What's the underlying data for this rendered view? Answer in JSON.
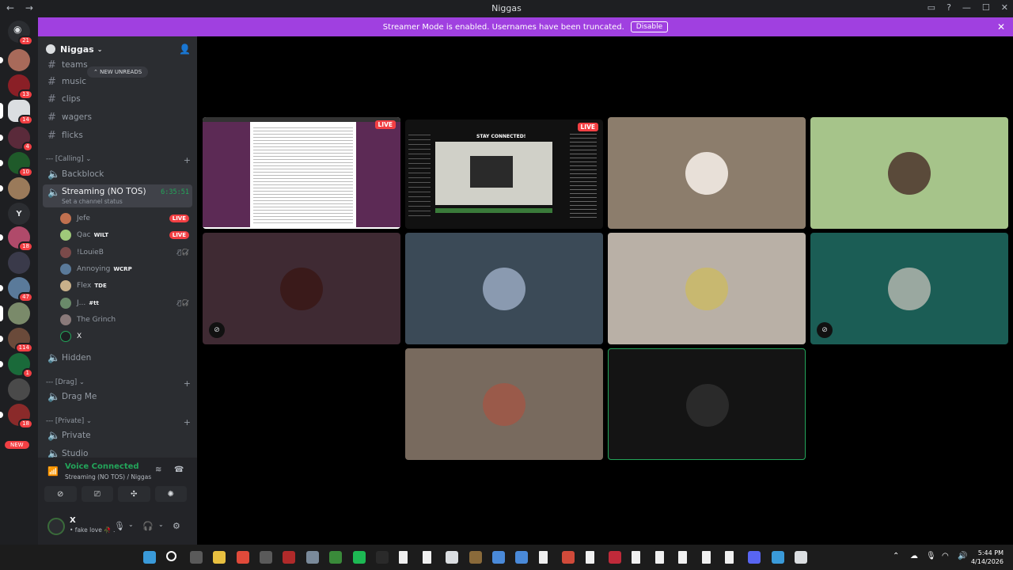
{
  "window": {
    "title": "Niggas",
    "back": "←",
    "forward": "→"
  },
  "banner": {
    "text": "Streamer Mode is enabled. Usernames have been truncated.",
    "disable": "Disable",
    "close": "✕"
  },
  "guilds": {
    "badges": [
      "21",
      "13",
      "14",
      "4",
      "10",
      "18",
      "47",
      "114",
      "1",
      "18"
    ],
    "letter_y": "Y",
    "new": "NEW"
  },
  "server": {
    "name": "Niggas"
  },
  "new_unreads": "NEW UNREADS",
  "text_channels": [
    "teams",
    "music",
    "clips",
    "wagers",
    "flicks"
  ],
  "categories": {
    "calling": "--- [Calling]",
    "drag": "--- [Drag]",
    "private": "--- [Private]"
  },
  "voice_channels": {
    "backblock": "Backblock",
    "streaming": "Streaming (NO TOS)",
    "streaming_status": "Set a channel status",
    "timer": "6:35:51",
    "hidden": "Hidden",
    "drag_me": "Drag Me",
    "private": "Private",
    "studio": "Studio"
  },
  "members": [
    {
      "name": "Jefe",
      "tag": "",
      "live": "LIVE",
      "muted": "",
      "color": "#c0704f"
    },
    {
      "name": "Qac",
      "tag": "WILT",
      "live": "LIVE",
      "muted": "",
      "color": "#9fc97a"
    },
    {
      "name": "!LouieB",
      "tag": "",
      "live": "",
      "muted": "🎙̸🎧̸",
      "color": "#7a4a4a"
    },
    {
      "name": "Annoying",
      "tag": "WCRP",
      "live": "",
      "muted": "",
      "color": "#5a7a9a"
    },
    {
      "name": "Flex",
      "tag": "TDE",
      "live": "",
      "muted": "",
      "color": "#c9b08a"
    },
    {
      "name": "J...",
      "tag": "#tt",
      "live": "",
      "muted": "🎙̸🎧̸",
      "color": "#6a8a6a"
    },
    {
      "name": "The Grinch",
      "tag": "",
      "live": "",
      "muted": "",
      "color": "#8a7a7a"
    },
    {
      "name": "X",
      "tag": "",
      "live": "",
      "muted": "",
      "color": "#1e1f22"
    }
  ],
  "voice_panel": {
    "title": "Voice Connected",
    "subtitle": "Streaming (NO TOS) / Niggas"
  },
  "user": {
    "name": "X",
    "status": "• fake love 🥀 ."
  },
  "stage": {
    "live_label": "LIVE",
    "screen_header": "STAY CONNECTED!",
    "tile_colors": [
      "#8c7d6c",
      "#a6c48a",
      "#3f2a33",
      "#3b4a57",
      "#b9b0a6",
      "#1b5d55",
      "#786a5e",
      "#141414"
    ]
  },
  "taskbar": {
    "time": "5:44 PM",
    "date": "4/14/2026"
  }
}
